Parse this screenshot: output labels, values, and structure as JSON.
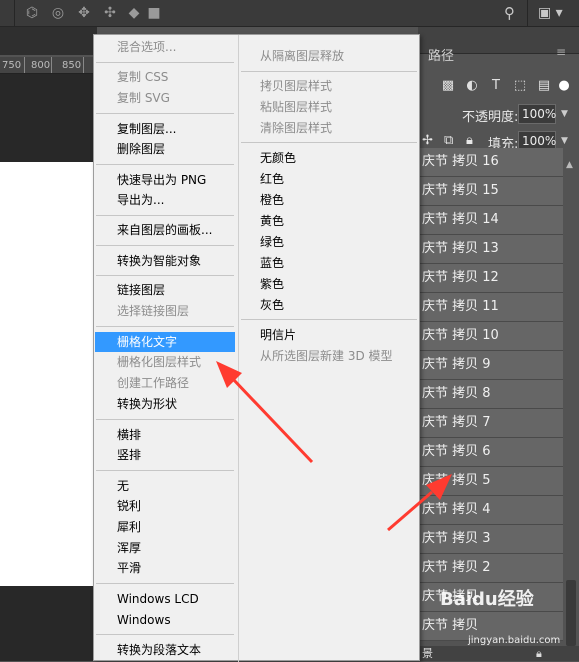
{
  "topbar": {
    "icons": [
      "chat-icon",
      "rotate-3d-icon",
      "orbit-icon",
      "pan-3d-icon",
      "slide-3d-icon",
      "scale-3d-icon",
      "search-icon",
      "workspace-icon"
    ]
  },
  "ruler": {
    "ticks": [
      "750",
      "800",
      "850"
    ]
  },
  "right_panel": {
    "tab_label": "路径",
    "opacity_label": "不透明度:",
    "opacity_value": "100%",
    "fill_label": "填充:",
    "fill_value": "100%",
    "layers": [
      "庆节 拷贝 16",
      "庆节 拷贝 15",
      "庆节 拷贝 14",
      "庆节 拷贝 13",
      "庆节 拷贝 12",
      "庆节 拷贝 11",
      "庆节 拷贝 10",
      "庆节 拷贝 9",
      "庆节 拷贝 8",
      "庆节 拷贝 7",
      "庆节 拷贝 6",
      "庆节 拷贝 5",
      "庆节 拷贝 4",
      "庆节 拷贝 3",
      "庆节 拷贝 2",
      "庆节 拷贝",
      "庆节 拷贝"
    ],
    "bottom_label": "景"
  },
  "context_menu": {
    "left": [
      {
        "label": "混合选项...",
        "disabled": true
      },
      {
        "label": "复制 CSS",
        "disabled": true
      },
      {
        "label": "复制 SVG",
        "disabled": true
      },
      {
        "label": "复制图层...",
        "disabled": false
      },
      {
        "label": "删除图层",
        "disabled": false
      },
      {
        "label": "快速导出为 PNG",
        "disabled": false
      },
      {
        "label": "导出为...",
        "disabled": false
      },
      {
        "label": "来自图层的画板...",
        "disabled": false
      },
      {
        "label": "转换为智能对象",
        "disabled": false
      },
      {
        "label": "链接图层",
        "disabled": false
      },
      {
        "label": "选择链接图层",
        "disabled": true
      },
      {
        "label": "栅格化文字",
        "disabled": false,
        "highlighted": true
      },
      {
        "label": "栅格化图层样式",
        "disabled": true
      },
      {
        "label": "创建工作路径",
        "disabled": true
      },
      {
        "label": "转换为形状",
        "disabled": false
      },
      {
        "label": "横排",
        "disabled": false
      },
      {
        "label": "竖排",
        "disabled": false
      },
      {
        "label": "无",
        "disabled": false
      },
      {
        "label": "锐利",
        "disabled": false
      },
      {
        "label": "犀利",
        "disabled": false
      },
      {
        "label": "浑厚",
        "disabled": false
      },
      {
        "label": "平滑",
        "disabled": false
      },
      {
        "label": "Windows LCD",
        "disabled": false
      },
      {
        "label": "Windows",
        "disabled": false
      },
      {
        "label": "转换为段落文本",
        "disabled": false
      }
    ],
    "right": [
      {
        "label": "从隔离图层释放",
        "disabled": true
      },
      {
        "label": "拷贝图层样式",
        "disabled": true
      },
      {
        "label": "粘贴图层样式",
        "disabled": true
      },
      {
        "label": "清除图层样式",
        "disabled": true
      },
      {
        "label": "无颜色",
        "disabled": false
      },
      {
        "label": "红色",
        "disabled": false
      },
      {
        "label": "橙色",
        "disabled": false
      },
      {
        "label": "黄色",
        "disabled": false
      },
      {
        "label": "绿色",
        "disabled": false
      },
      {
        "label": "蓝色",
        "disabled": false
      },
      {
        "label": "紫色",
        "disabled": false
      },
      {
        "label": "灰色",
        "disabled": false
      },
      {
        "label": "明信片",
        "disabled": false
      },
      {
        "label": "从所选图层新建 3D 模型",
        "disabled": true
      }
    ]
  },
  "watermark": {
    "logo": "Baidu经验",
    "url": "jingyan.baidu.com"
  },
  "colors": {
    "highlight": "#3399ff",
    "arrow": "#ff3b30"
  }
}
